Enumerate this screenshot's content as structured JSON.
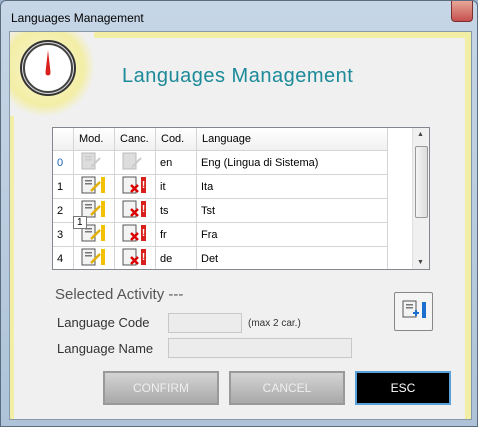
{
  "window": {
    "title": "Languages Management"
  },
  "header": {
    "title": "Languages Management"
  },
  "grid": {
    "columns": [
      "Mod.",
      "Canc.",
      "Cod.",
      "Language"
    ],
    "rows": [
      {
        "index": "0",
        "code": "en",
        "language": "Eng (Lingua di Sistema)"
      },
      {
        "index": "1",
        "code": "it",
        "language": "Ita"
      },
      {
        "index": "2",
        "code": "ts",
        "language": "Tst"
      },
      {
        "index": "3",
        "code": "fr",
        "language": "Fra"
      },
      {
        "index": "4",
        "code": "de",
        "language": "Det"
      }
    ],
    "tooltip": "1"
  },
  "form": {
    "selected_activity_label": "Selected Activity",
    "selected_activity_value": "---",
    "language_code_label": "Language Code",
    "language_code_hint": "(max 2 car.)",
    "language_code_value": "",
    "language_name_label": "Language Name",
    "language_name_value": ""
  },
  "buttons": {
    "confirm": "CONFIRM",
    "cancel": "CANCEL",
    "esc": "ESC"
  },
  "icons": [
    "app-logo-icon",
    "edit-icon",
    "delete-icon",
    "new-language-icon"
  ]
}
